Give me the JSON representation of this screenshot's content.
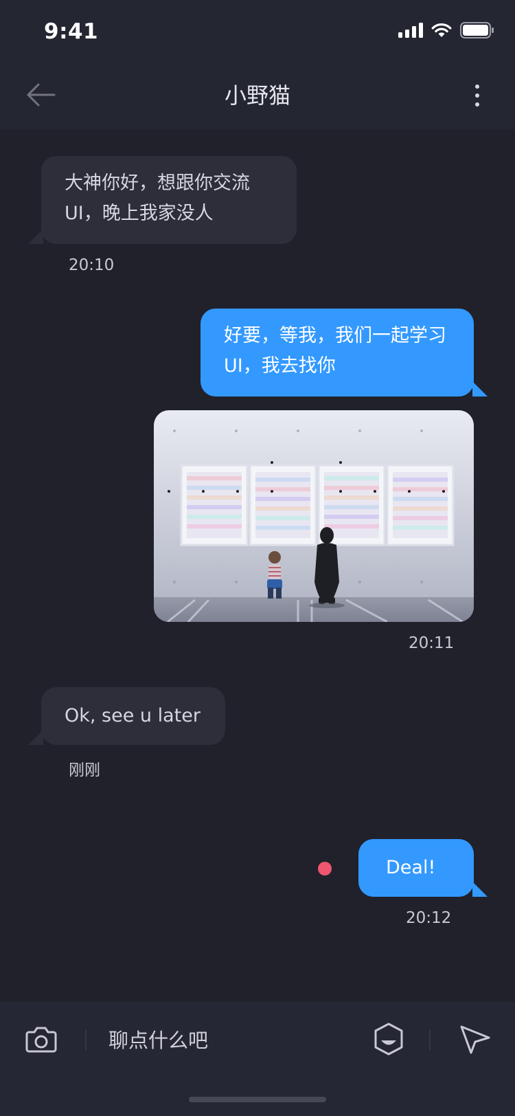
{
  "status_bar": {
    "time": "9:41"
  },
  "navbar": {
    "title": "小野猫",
    "back_icon": "arrow-left-icon",
    "more_icon": "more-vertical-icon"
  },
  "messages": [
    {
      "direction": "in",
      "type": "text",
      "text": "大神你好，想跟你交流UI，晚上我家没人",
      "time": "20:10"
    },
    {
      "direction": "out",
      "type": "text",
      "text": "好要，等我，我们一起学习UI，我去找你",
      "time": ""
    },
    {
      "direction": "out",
      "type": "image",
      "image_icon": "photo-image",
      "time": "20:11"
    },
    {
      "direction": "in",
      "type": "text",
      "text": "Ok, see u later",
      "time": "刚刚"
    },
    {
      "direction": "out",
      "type": "text",
      "text": "Deal!",
      "time": "20:12",
      "unread_dot_color": "#f0566f"
    }
  ],
  "input_bar": {
    "placeholder": "聊点什么吧",
    "camera_icon": "camera-icon",
    "emoji_icon": "emoji-icon",
    "send_icon": "send-icon"
  },
  "colors": {
    "background": "#20212b",
    "bar": "#242631",
    "incoming_bubble": "#2d2e3a",
    "outgoing_bubble": "#3399ff"
  }
}
